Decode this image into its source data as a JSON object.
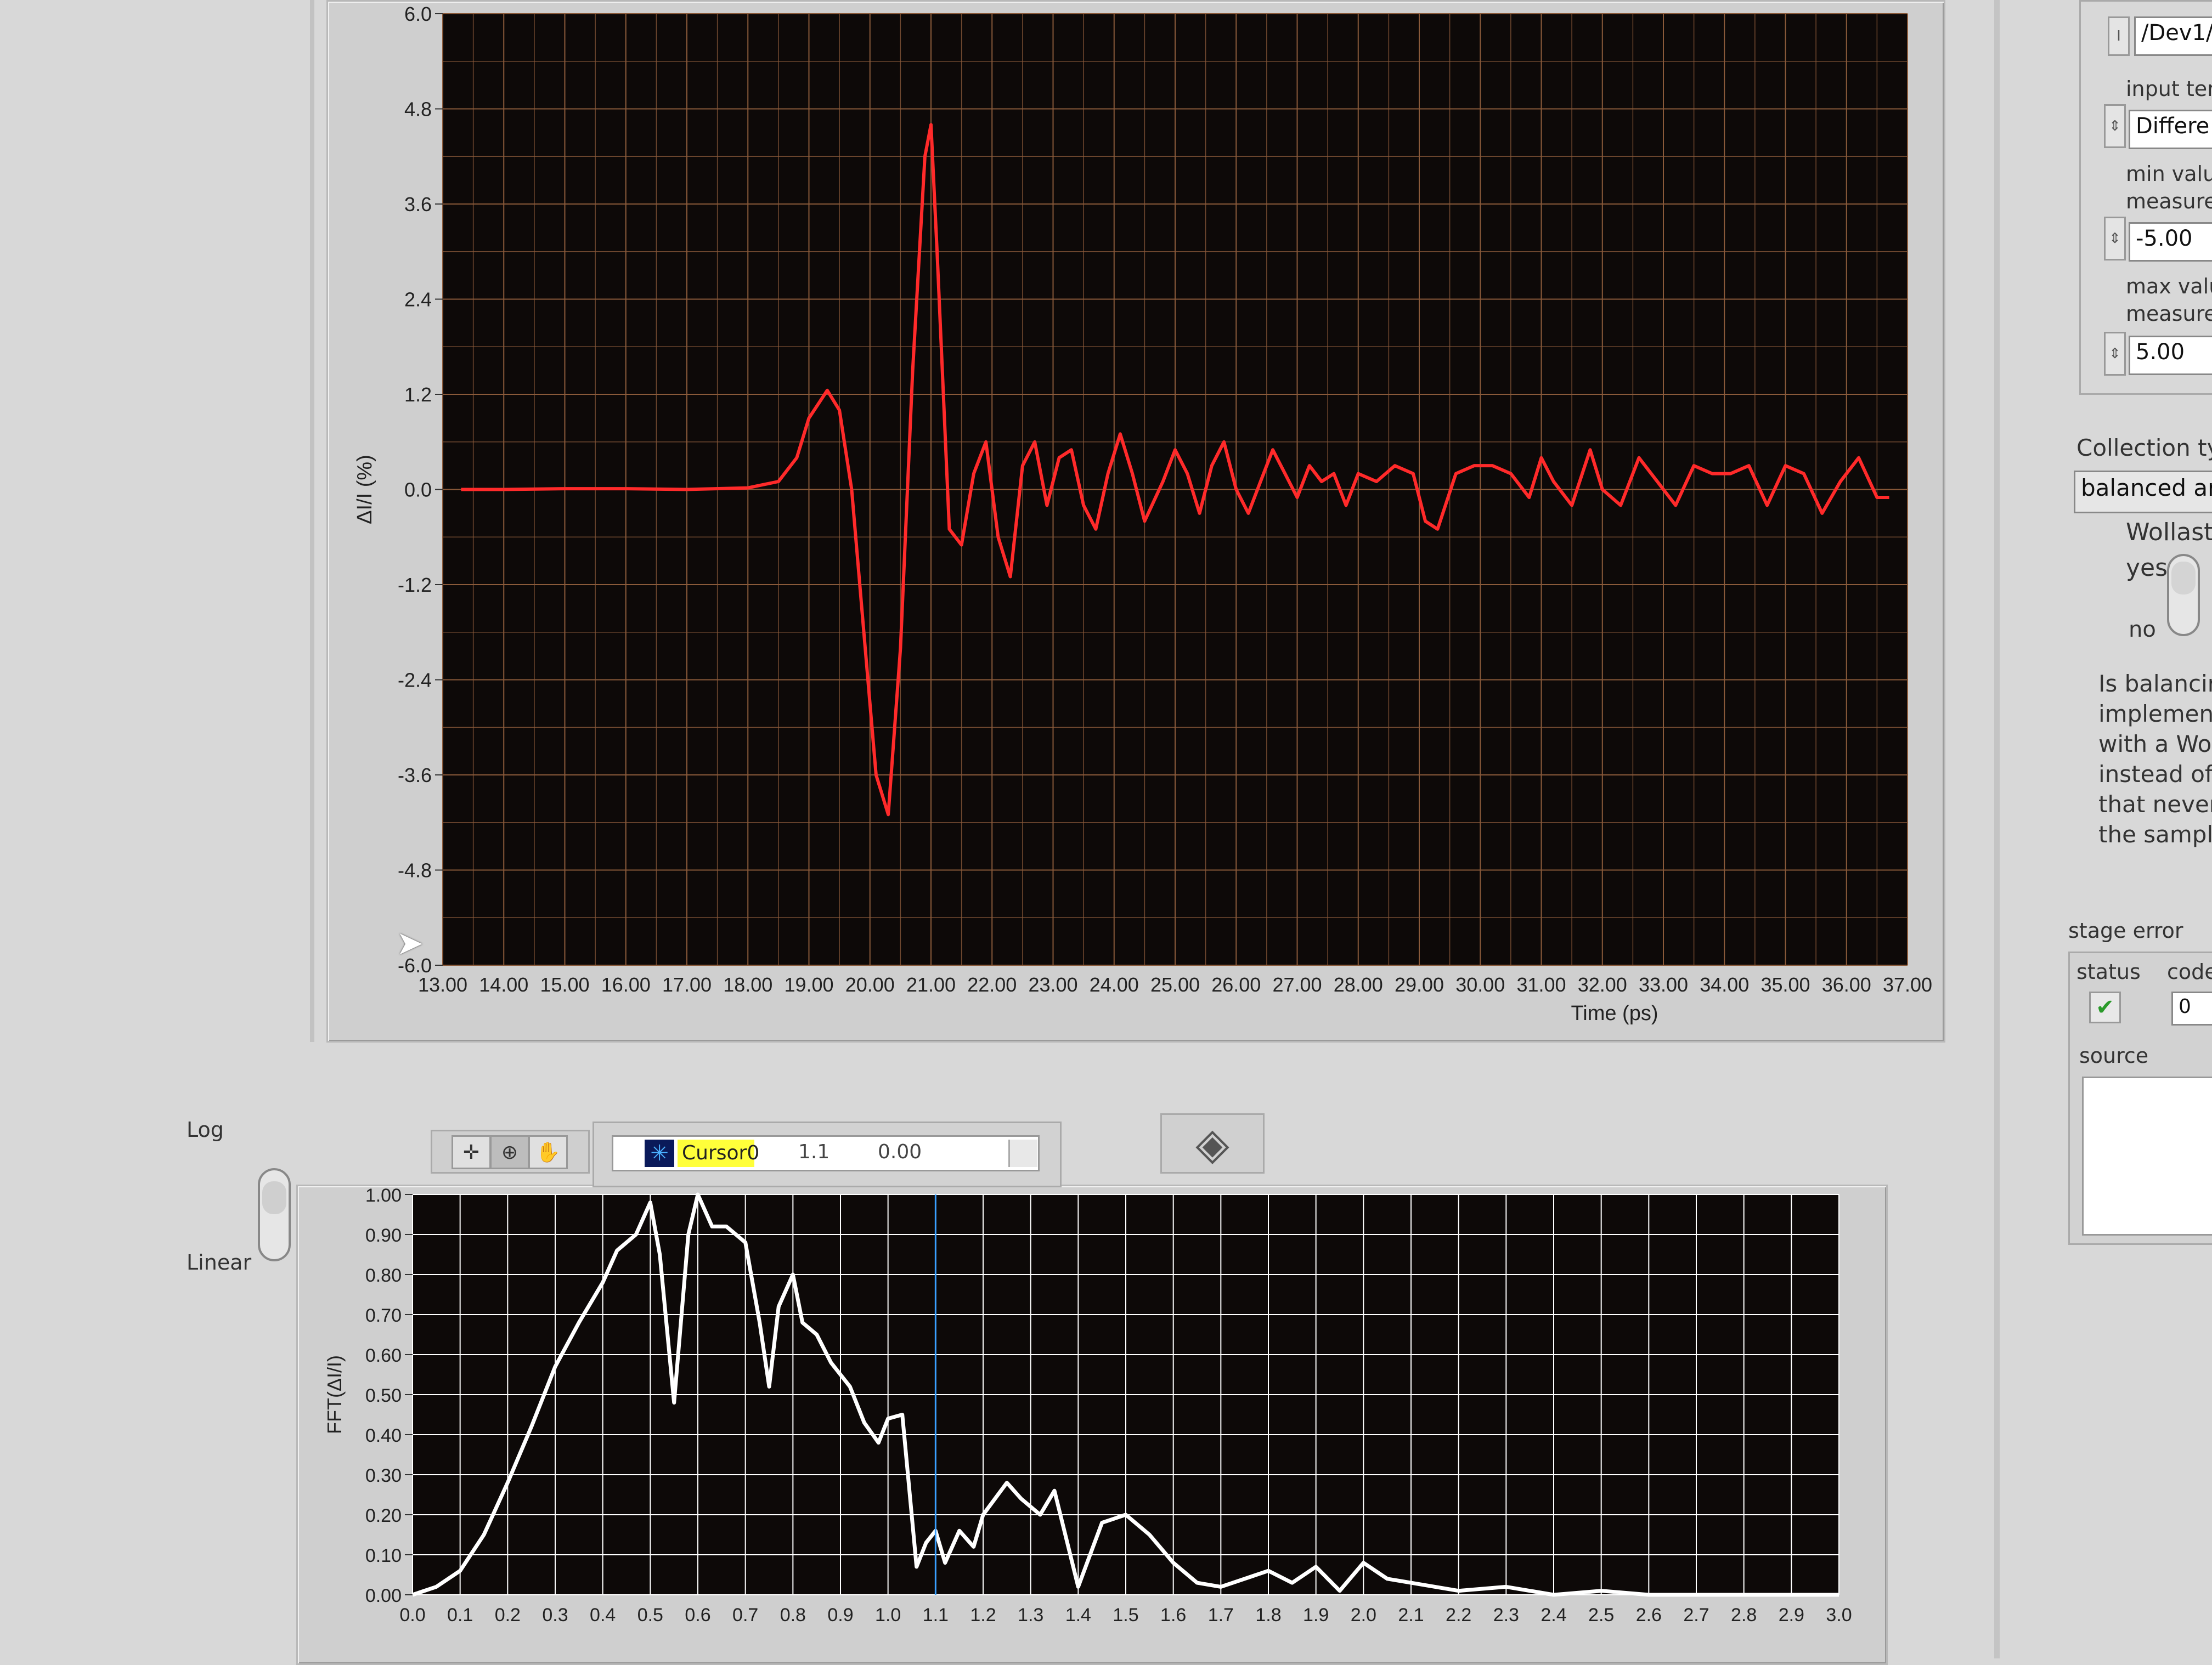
{
  "top_graph": {
    "ylabel": "ΔI/I (%)",
    "xlabel": "Time (ps)",
    "y_ticks": [
      "6.0",
      "4.8",
      "3.6",
      "2.4",
      "1.2",
      "0.0",
      "-1.2",
      "-2.4",
      "-3.6",
      "-4.8",
      "-6.0"
    ],
    "x_ticks": [
      "13.00",
      "14.00",
      "15.00",
      "16.00",
      "17.00",
      "18.00",
      "19.00",
      "20.00",
      "21.00",
      "22.00",
      "23.00",
      "24.00",
      "25.00",
      "26.00",
      "27.00",
      "28.00",
      "29.00",
      "30.00",
      "31.00",
      "32.00",
      "33.00",
      "34.00",
      "35.00",
      "36.00",
      "37.00"
    ]
  },
  "bottom_graph": {
    "ylabel": "FFT(ΔI/I)",
    "y_ticks": [
      "1.00",
      "0.90",
      "0.80",
      "0.70",
      "0.60",
      "0.50",
      "0.40",
      "0.30",
      "0.20",
      "0.10",
      "0.00"
    ],
    "x_ticks": [
      "0.0",
      "0.1",
      "0.2",
      "0.3",
      "0.4",
      "0.5",
      "0.6",
      "0.7",
      "0.8",
      "0.9",
      "1.0",
      "1.1",
      "1.2",
      "1.3",
      "1.4",
      "1.5",
      "1.6",
      "1.7",
      "1.8",
      "1.9",
      "2.0",
      "2.1",
      "2.2",
      "2.3",
      "2.4",
      "2.5",
      "2.6",
      "2.7",
      "2.8",
      "2.9",
      "3.0"
    ]
  },
  "scale_toggle": {
    "top_label": "Log",
    "bottom_label": "Linear"
  },
  "cursor": {
    "name": "Cursor0",
    "x": "1.1",
    "y": "0.00"
  },
  "right_panel": {
    "device": "/Dev1/",
    "input_term_label": "input ter",
    "input_term_value": "Differe",
    "min_label_1": "min valu",
    "min_label_2": "measure",
    "min_value": "-5.00",
    "max_label_1": "max valu",
    "max_label_2": "measure",
    "max_value": "5.00",
    "collection_label": "Collection ty",
    "collection_value": "balanced ar",
    "wollaston_label": "Wollast",
    "yes_label": "yes",
    "no_label": "no",
    "note_lines": [
      "Is balancir",
      "implement",
      "with a Wo",
      "instead of",
      "that never",
      "the sampl"
    ],
    "stage_error_label": "stage error",
    "status_label": "status",
    "code_label": "code",
    "code_value": "0",
    "source_label": "source"
  },
  "colors": {
    "time_trace": "#ff2a2a",
    "fft_trace": "#ffffff",
    "top_grid": "#8a5a3a",
    "plot_bg": "#0d0908",
    "cursor_line": "#3aa0ff",
    "cursor_name_bg": "#ffff3a"
  },
  "chart_data": [
    {
      "type": "line",
      "xlabel": "Time (ps)",
      "ylabel": "ΔI/I (%)",
      "xlim": [
        13,
        37
      ],
      "ylim": [
        -6,
        6
      ],
      "grid": true,
      "series": [
        {
          "x": [
            13.3,
            14,
            15,
            16,
            17,
            18,
            18.5,
            18.8,
            19.0,
            19.3,
            19.5,
            19.7,
            19.9,
            20.1,
            20.3,
            20.5,
            20.7,
            20.9,
            21.0,
            21.1,
            21.3,
            21.5,
            21.7,
            21.9,
            22.1,
            22.3,
            22.5,
            22.7,
            22.9,
            23.1,
            23.3,
            23.5,
            23.7,
            23.9,
            24.1,
            24.3,
            24.5,
            24.8,
            25.0,
            25.2,
            25.4,
            25.6,
            25.8,
            26.0,
            26.2,
            26.4,
            26.6,
            26.8,
            27.0,
            27.2,
            27.4,
            27.6,
            27.8,
            28.0,
            28.3,
            28.6,
            28.9,
            29.1,
            29.3,
            29.6,
            29.9,
            30.2,
            30.5,
            30.8,
            31.0,
            31.2,
            31.5,
            31.8,
            32.0,
            32.3,
            32.6,
            32.9,
            33.2,
            33.5,
            33.8,
            34.1,
            34.4,
            34.7,
            35.0,
            35.3,
            35.6,
            35.9,
            36.2,
            36.5,
            36.7
          ],
          "y": [
            0.0,
            0.0,
            0.01,
            0.01,
            0.0,
            0.02,
            0.1,
            0.4,
            0.9,
            1.25,
            1.0,
            0.0,
            -1.8,
            -3.6,
            -4.1,
            -2.0,
            1.5,
            4.2,
            4.6,
            3.0,
            -0.5,
            -0.7,
            0.2,
            0.6,
            -0.6,
            -1.1,
            0.3,
            0.6,
            -0.2,
            0.4,
            0.5,
            -0.2,
            -0.5,
            0.2,
            0.7,
            0.2,
            -0.4,
            0.1,
            0.5,
            0.2,
            -0.3,
            0.3,
            0.6,
            0.0,
            -0.3,
            0.1,
            0.5,
            0.2,
            -0.1,
            0.3,
            0.1,
            0.2,
            -0.2,
            0.2,
            0.1,
            0.3,
            0.2,
            -0.4,
            -0.5,
            0.2,
            0.3,
            0.3,
            0.2,
            -0.1,
            0.4,
            0.1,
            -0.2,
            0.5,
            0.0,
            -0.2,
            0.4,
            0.1,
            -0.2,
            0.3,
            0.2,
            0.2,
            0.3,
            -0.2,
            0.3,
            0.2,
            -0.3,
            0.1,
            0.4,
            -0.1,
            -0.1
          ]
        }
      ]
    },
    {
      "type": "line",
      "ylabel": "FFT(ΔI/I)",
      "xlim": [
        0.0,
        3.0
      ],
      "ylim": [
        0.0,
        1.0
      ],
      "grid": true,
      "series": [
        {
          "x": [
            0.0,
            0.05,
            0.1,
            0.15,
            0.2,
            0.25,
            0.3,
            0.35,
            0.4,
            0.43,
            0.45,
            0.47,
            0.5,
            0.52,
            0.55,
            0.58,
            0.6,
            0.63,
            0.66,
            0.7,
            0.73,
            0.75,
            0.77,
            0.8,
            0.82,
            0.85,
            0.88,
            0.92,
            0.95,
            0.98,
            1.0,
            1.03,
            1.06,
            1.08,
            1.1,
            1.12,
            1.15,
            1.18,
            1.2,
            1.25,
            1.28,
            1.32,
            1.35,
            1.4,
            1.45,
            1.5,
            1.55,
            1.6,
            1.65,
            1.7,
            1.75,
            1.8,
            1.85,
            1.9,
            1.95,
            2.0,
            2.05,
            2.1,
            2.2,
            2.3,
            2.4,
            2.5,
            2.6,
            2.7,
            2.8,
            2.9,
            3.0
          ],
          "y": [
            0.0,
            0.02,
            0.06,
            0.15,
            0.28,
            0.42,
            0.57,
            0.68,
            0.78,
            0.86,
            0.88,
            0.9,
            0.98,
            0.85,
            0.48,
            0.9,
            1.0,
            0.92,
            0.92,
            0.88,
            0.68,
            0.52,
            0.72,
            0.8,
            0.68,
            0.65,
            0.58,
            0.52,
            0.43,
            0.38,
            0.44,
            0.45,
            0.07,
            0.13,
            0.16,
            0.08,
            0.16,
            0.12,
            0.2,
            0.28,
            0.24,
            0.2,
            0.26,
            0.02,
            0.18,
            0.2,
            0.15,
            0.08,
            0.03,
            0.02,
            0.04,
            0.06,
            0.03,
            0.07,
            0.01,
            0.08,
            0.04,
            0.03,
            0.01,
            0.02,
            0.0,
            0.01,
            0.0,
            0.0,
            0.0,
            0.0,
            0.0
          ]
        }
      ]
    }
  ]
}
